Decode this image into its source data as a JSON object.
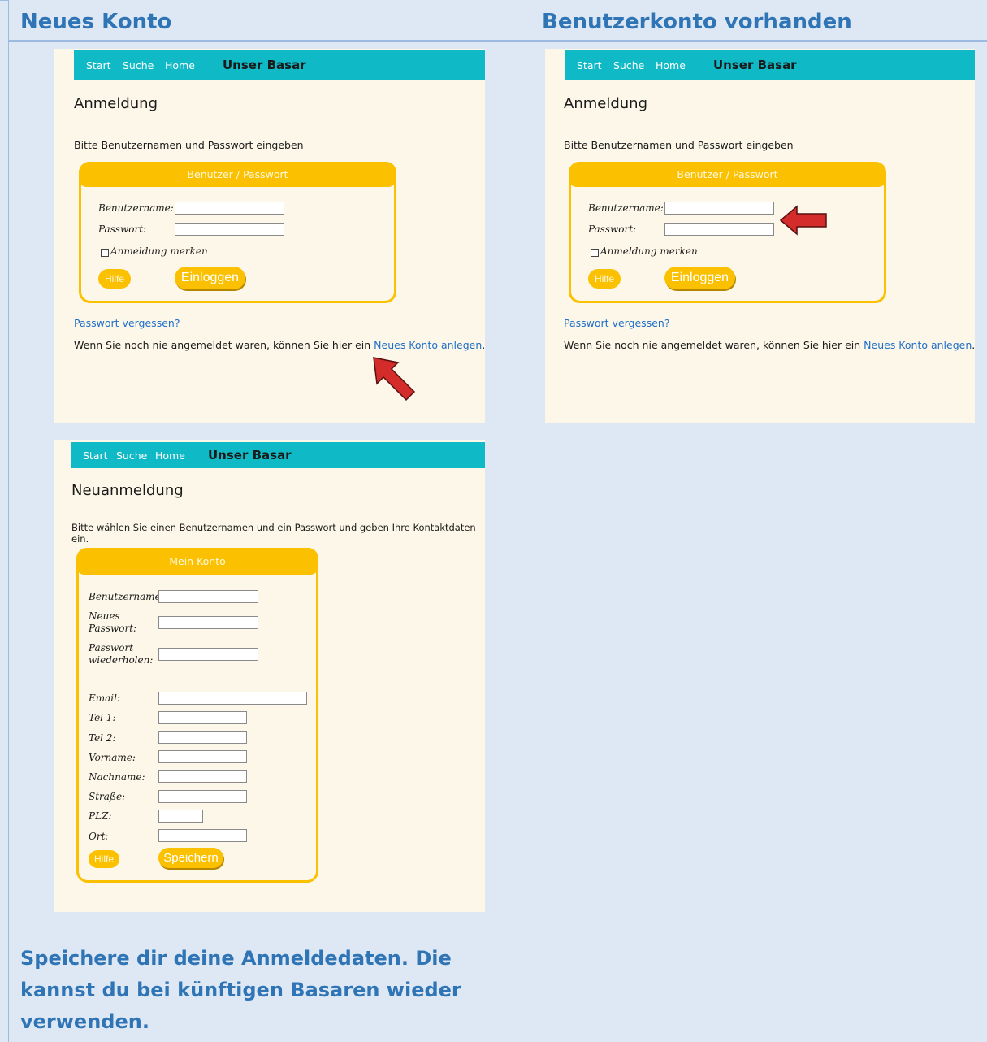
{
  "columns": {
    "left_header": "Neues Konto",
    "right_header": "Benutzerkonto vorhanden"
  },
  "nav": {
    "start": "Start",
    "suche": "Suche",
    "home": "Home",
    "brand": "Unser Basar"
  },
  "login": {
    "heading": "Anmeldung",
    "intro": "Bitte Benutzernamen und Passwort eingeben",
    "panel_title": "Benutzer / Passwort",
    "username_label": "Benutzername:",
    "password_label": "Passwort:",
    "remember_label": "Anmeldung merken",
    "help_button": "Hilfe",
    "login_button": "Einloggen",
    "forgot_link": "Passwort vergessen?",
    "new_account_prefix": "Wenn Sie noch nie angemeldet waren, können Sie hier ein ",
    "new_account_link": "Neues Konto anlegen",
    "new_account_suffix": "."
  },
  "register": {
    "heading": "Neuanmeldung",
    "intro": "Bitte wählen Sie einen Benutzernamen und ein Passwort und geben Ihre Kontaktdaten ein.",
    "panel_title": "Mein Konto",
    "labels": {
      "username": "Benutzername:",
      "new_password": "Neues Passwort:",
      "repeat_password": "Passwort wiederholen:",
      "email": "Email:",
      "tel1": "Tel 1:",
      "tel2": "Tel 2:",
      "vorname": "Vorname:",
      "nachname": "Nachname:",
      "strasse": "Straße:",
      "plz": "PLZ:",
      "ort": "Ort:"
    },
    "help_button": "Hilfe",
    "save_button": "Speichern"
  },
  "footer_note": "Speichere dir deine Anmeldedaten. Die kannst du bei künftigen Basaren wieder verwenden.",
  "colors": {
    "accent": "#fbc100",
    "nav": "#0fb9c6",
    "heading_blue": "#2f74b5",
    "arrow": "#d42b2b"
  },
  "icons": {
    "arrow_left_shot": "red-arrow-icon",
    "arrow_right_shot": "red-arrow-icon"
  }
}
